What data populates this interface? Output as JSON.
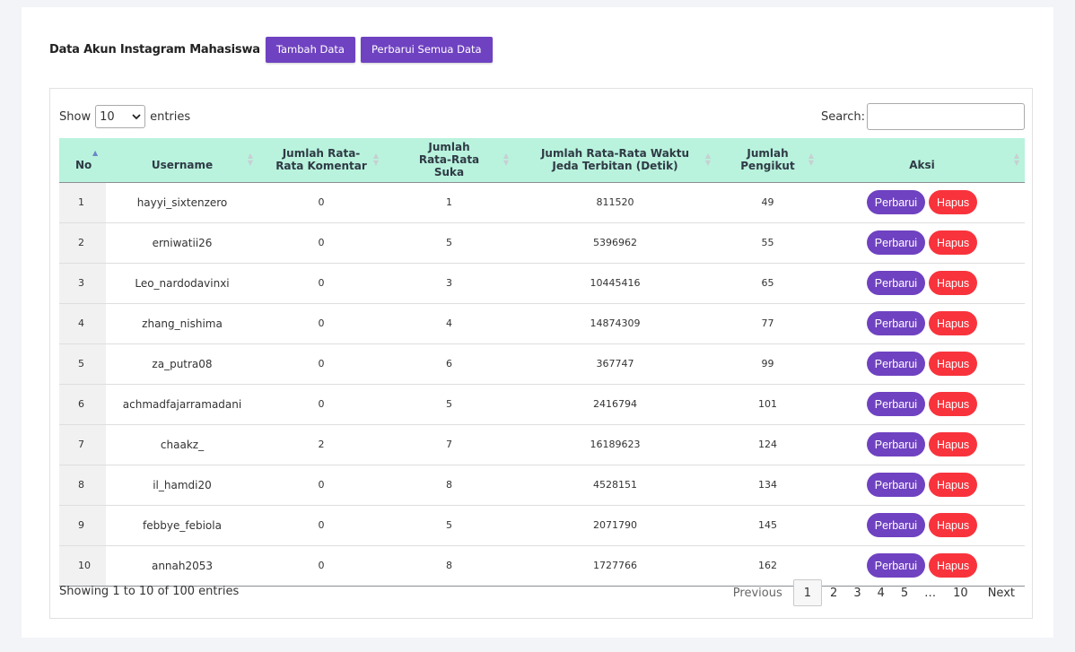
{
  "header": {
    "title": "Data Akun Instagram Mahasiswa",
    "add_label": "Tambah Data",
    "update_all_label": "Perbarui Semua Data"
  },
  "toolbar": {
    "show_label": "Show",
    "page_length": "10",
    "entries_label": "entries",
    "search_label": "Search:",
    "search_value": ""
  },
  "table": {
    "columns": [
      "No",
      "Username",
      "Jumlah Rata-Rata Komentar",
      "Jumlah Rata-Rata Suka",
      "Jumlah Rata-Rata Waktu Jeda Terbitan (Detik)",
      "Jumlah Pengikut",
      "Aksi"
    ],
    "update_label": "Perbarui",
    "delete_label": "Hapus",
    "rows": [
      {
        "no": "1",
        "username": "hayyi_sixtenzero",
        "komentar": "0",
        "suka": "1",
        "jeda": "811520",
        "pengikut": "49"
      },
      {
        "no": "2",
        "username": "erniwatii26",
        "komentar": "0",
        "suka": "5",
        "jeda": "5396962",
        "pengikut": "55"
      },
      {
        "no": "3",
        "username": "Leo_nardodavinxi",
        "komentar": "0",
        "suka": "3",
        "jeda": "10445416",
        "pengikut": "65"
      },
      {
        "no": "4",
        "username": "zhang_nishima",
        "komentar": "0",
        "suka": "4",
        "jeda": "14874309",
        "pengikut": "77"
      },
      {
        "no": "5",
        "username": "za_putra08",
        "komentar": "0",
        "suka": "6",
        "jeda": "367747",
        "pengikut": "99"
      },
      {
        "no": "6",
        "username": "achmadfajarramadani",
        "komentar": "0",
        "suka": "5",
        "jeda": "2416794",
        "pengikut": "101"
      },
      {
        "no": "7",
        "username": "chaakz_",
        "komentar": "2",
        "suka": "7",
        "jeda": "16189623",
        "pengikut": "124"
      },
      {
        "no": "8",
        "username": "il_hamdi20",
        "komentar": "0",
        "suka": "8",
        "jeda": "4528151",
        "pengikut": "134"
      },
      {
        "no": "9",
        "username": "febbye_febiola",
        "komentar": "0",
        "suka": "5",
        "jeda": "2071790",
        "pengikut": "145"
      },
      {
        "no": "10",
        "username": "annah2053",
        "komentar": "0",
        "suka": "8",
        "jeda": "1727766",
        "pengikut": "162"
      }
    ]
  },
  "footer": {
    "info": "Showing 1 to 10 of 100 entries",
    "prev_label": "Previous",
    "next_label": "Next",
    "pages": [
      "1",
      "2",
      "3",
      "4",
      "5",
      "…",
      "10"
    ],
    "current_page": "1"
  },
  "colors": {
    "accent_purple": "#6f42c1",
    "delete_red": "#f8333c",
    "header_mint": "#b9f3dd"
  },
  "icons": {
    "select_caret": "chevron-down-icon",
    "sort": "sort-icon"
  }
}
